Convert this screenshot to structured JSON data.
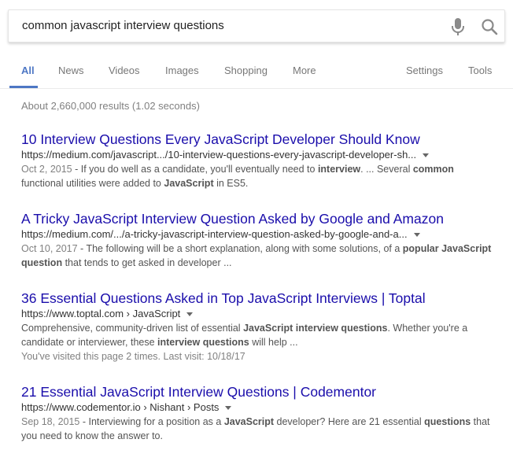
{
  "search": {
    "query": "common javascript interview questions"
  },
  "tabs": [
    {
      "label": "All",
      "active": true
    },
    {
      "label": "News"
    },
    {
      "label": "Videos"
    },
    {
      "label": "Images"
    },
    {
      "label": "Shopping"
    },
    {
      "label": "More"
    },
    {
      "label": "Settings"
    },
    {
      "label": "Tools"
    }
  ],
  "stats": "About 2,660,000 results (1.02 seconds)",
  "results": [
    {
      "title": "10 Interview Questions Every JavaScript Developer Should Know",
      "url": "https://medium.com/javascript.../10-interview-questions-every-javascript-developer-sh...",
      "snippet": [
        {
          "t": "Oct 2, 2015",
          "k": "date"
        },
        {
          "t": " - If you do well as a candidate, you'll eventually need to "
        },
        {
          "t": "interview",
          "k": "b"
        },
        {
          "t": ". ... Several "
        },
        {
          "t": "common",
          "k": "b"
        },
        {
          "t": " functional utilities were added to "
        },
        {
          "t": "JavaScript",
          "k": "b"
        },
        {
          "t": " in ES5."
        }
      ]
    },
    {
      "title": "A Tricky JavaScript Interview Question Asked by Google and Amazon",
      "url": "https://medium.com/.../a-tricky-javascript-interview-question-asked-by-google-and-a...",
      "snippet": [
        {
          "t": "Oct 10, 2017",
          "k": "date"
        },
        {
          "t": " - The following will be a short explanation, along with some solutions, of a "
        },
        {
          "t": "popular",
          "k": "b"
        },
        {
          "t": " "
        },
        {
          "t": "JavaScript question",
          "k": "b"
        },
        {
          "t": " that tends to get asked in developer ..."
        }
      ]
    },
    {
      "title": "36 Essential Questions Asked in Top JavaScript Interviews | Toptal",
      "url": "https://www.toptal.com › JavaScript",
      "snippet": [
        {
          "t": "Comprehensive, community-driven list of essential "
        },
        {
          "t": "JavaScript interview questions",
          "k": "b"
        },
        {
          "t": ". Whether you're a candidate or interviewer, these "
        },
        {
          "t": "interview questions",
          "k": "b"
        },
        {
          "t": " will help ..."
        }
      ],
      "visited": "You've visited this page 2 times. Last visit: 10/18/17"
    },
    {
      "title": "21 Essential JavaScript Interview Questions | Codementor",
      "url": "https://www.codementor.io › Nishant › Posts",
      "snippet": [
        {
          "t": "Sep 18, 2015",
          "k": "date"
        },
        {
          "t": " - Interviewing for a position as a "
        },
        {
          "t": "JavaScript",
          "k": "b"
        },
        {
          "t": " developer? Here are 21 essential "
        },
        {
          "t": "questions",
          "k": "b"
        },
        {
          "t": " that you need to know the answer to."
        }
      ]
    }
  ]
}
